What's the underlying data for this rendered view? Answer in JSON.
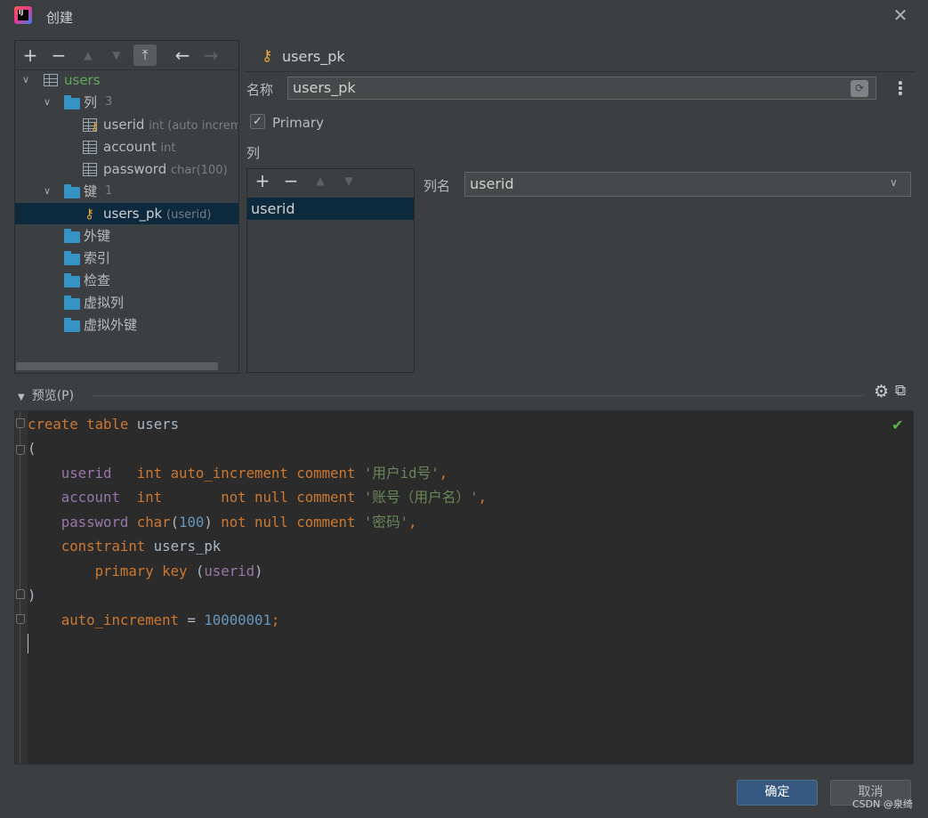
{
  "window": {
    "title": "创建"
  },
  "tree": {
    "table_name": "users",
    "columns_folder": {
      "label": "列",
      "count": "3"
    },
    "columns": [
      {
        "name": "userid",
        "type": "int (auto increme"
      },
      {
        "name": "account",
        "type": "int"
      },
      {
        "name": "password",
        "type": "char(100)"
      }
    ],
    "keys_folder": {
      "label": "键",
      "count": "1"
    },
    "key": {
      "name": "users_pk",
      "detail": "(userid)"
    },
    "folders": [
      "外键",
      "索引",
      "检查",
      "虚拟列",
      "虚拟外键"
    ]
  },
  "detail": {
    "header": "users_pk",
    "name_label": "名称",
    "name_value": "users_pk",
    "primary_label": "Primary",
    "primary_checked": true,
    "columns_label": "列",
    "columns_list": [
      "userid"
    ],
    "colname_label": "列名",
    "colname_value": "userid"
  },
  "preview": {
    "label": "预览(P)",
    "code": {
      "l1a": "create",
      "l1b": " ",
      "l1c": "table",
      "l1d": " users",
      "l2": "(",
      "l3a": "    ",
      "l3b": "userid",
      "l3c": "   ",
      "l3d": "int auto_increment comment",
      "l3e": " ",
      "l3f": "'用户id号'",
      "l3g": ",",
      "l4a": "    ",
      "l4b": "account",
      "l4c": "  ",
      "l4d": "int",
      "l4e": "       ",
      "l4f": "not null comment",
      "l4g": " ",
      "l4h": "'账号（用户名）'",
      "l4i": ",",
      "l5a": "    ",
      "l5b": "password",
      "l5c": " ",
      "l5d": "char",
      "l5e": "(",
      "l5f": "100",
      "l5g": ") ",
      "l5h": "not null comment",
      "l5i": " ",
      "l5j": "'密码'",
      "l5k": ",",
      "l6a": "    ",
      "l6b": "constraint",
      "l6c": " users_pk",
      "l7a": "        ",
      "l7b": "primary key",
      "l7c": " (",
      "l7d": "userid",
      "l7e": ")",
      "l8": ")",
      "l9a": "    ",
      "l9b": "auto_increment",
      "l9c": " = ",
      "l9d": "10000001",
      "l9e": ";"
    }
  },
  "buttons": {
    "ok": "确定",
    "cancel": "取消"
  },
  "watermark": "CSDN @泉绮",
  "colors": {
    "accent": "#365880",
    "selection": "#0d293e",
    "keyword": "#cc7832",
    "string": "#6a8759",
    "number": "#6897bb",
    "field": "#9876aa"
  }
}
